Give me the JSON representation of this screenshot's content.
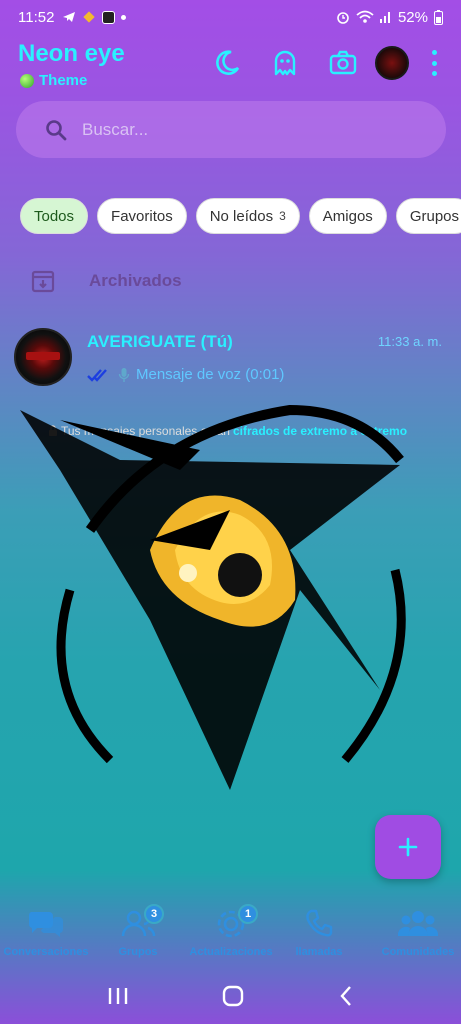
{
  "status_bar": {
    "time": "11:52",
    "battery": "52%"
  },
  "header": {
    "title": "Neon eye",
    "subtitle": "Theme"
  },
  "search": {
    "placeholder": "Buscar..."
  },
  "filters": [
    {
      "label": "Todos",
      "active": true
    },
    {
      "label": "Favoritos"
    },
    {
      "label": "No leídos",
      "count": "3"
    },
    {
      "label": "Amigos"
    },
    {
      "label": "Grupos"
    }
  ],
  "archived": {
    "label": "Archivados"
  },
  "chats": [
    {
      "name": "AVERIGUATE (Tú)",
      "time": "11:33 a. m.",
      "preview": "Mensaje de voz (0:01)"
    }
  ],
  "encryption": {
    "prefix": "Tus mensajes personales están",
    "link": "cifrados de extremo a extremo"
  },
  "bottom_nav": [
    {
      "label": "Conversaciones"
    },
    {
      "label": "Grupos",
      "badge": "3"
    },
    {
      "label": "Actualizaciones",
      "badge": "1"
    },
    {
      "label": "llamadas"
    },
    {
      "label": "Comunidades"
    }
  ],
  "colors": {
    "accent": "#2af0ff",
    "nav": "#2f8fe0",
    "fab": "#a04ce3"
  }
}
